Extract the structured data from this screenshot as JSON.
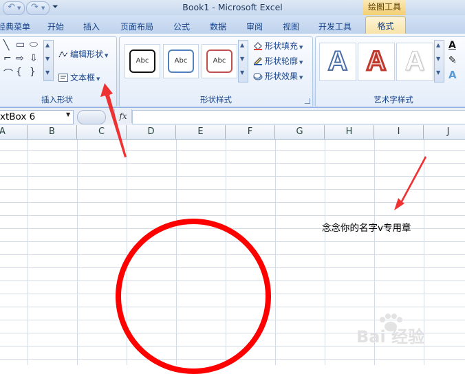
{
  "window": {
    "title": "Book1 - Microsoft Excel",
    "context_group": "绘图工具"
  },
  "tabs": [
    {
      "label": "经典菜单"
    },
    {
      "label": "开始"
    },
    {
      "label": "插入"
    },
    {
      "label": "页面布局"
    },
    {
      "label": "公式"
    },
    {
      "label": "数据"
    },
    {
      "label": "审阅"
    },
    {
      "label": "视图"
    },
    {
      "label": "开发工具"
    },
    {
      "label": "格式"
    }
  ],
  "ribbon": {
    "insert_shapes": {
      "label": "插入形状",
      "edit_shape": "编辑形状",
      "text_box": "文本框"
    },
    "shape_styles": {
      "label": "形状样式",
      "style_sample": "Abc",
      "fill": "形状填充",
      "outline": "形状轮廓",
      "effects": "形状效果"
    },
    "wordart_styles": {
      "label": "艺术字样式",
      "letter": "A"
    }
  },
  "formula_bar": {
    "name_box": "xtBox 6",
    "fx": "fx",
    "value": ""
  },
  "columns": [
    "A",
    "B",
    "C",
    "D",
    "E",
    "F",
    "G",
    "H",
    "I",
    "J"
  ],
  "sheet": {
    "text_box_content": "念念你的名字v专用章"
  },
  "colors": {
    "accent": "#ff0000",
    "ribbon_blue": "#15428b",
    "context_tab": "#f7e2a6"
  },
  "watermark": {
    "text": "Bai 经验"
  }
}
